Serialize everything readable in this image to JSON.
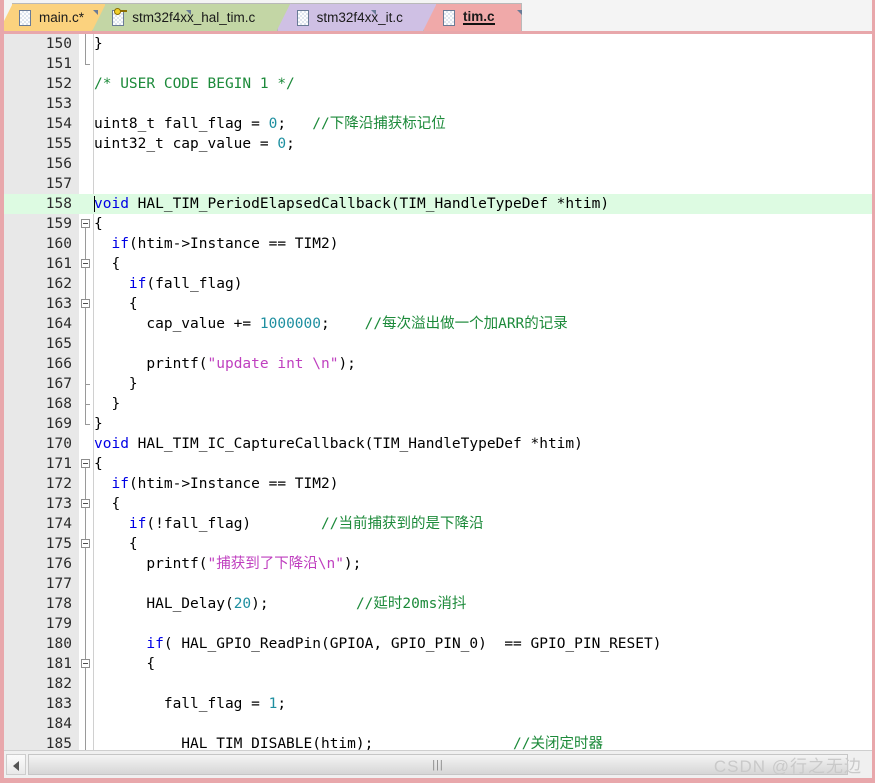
{
  "tabs": [
    {
      "label": "main.c*",
      "color": "#fbd27e",
      "icon": "file-icon",
      "active": false,
      "modified": true
    },
    {
      "label": "stm32f4xx_hal_tim.c",
      "color": "#c3d6a5",
      "icon": "file-key-icon",
      "active": false,
      "modified": false
    },
    {
      "label": "stm32f4xx_it.c",
      "color": "#cfc0e4",
      "icon": "file-icon",
      "active": false,
      "modified": false
    },
    {
      "label": "tim.c",
      "color": "#f0a9a9",
      "icon": "file-icon",
      "active": true,
      "modified": false
    }
  ],
  "editor": {
    "language": "c",
    "current_line": 158,
    "colors": {
      "keyword": "#0000e6",
      "comment": "#1c8a3a",
      "string": "#bf3fbf",
      "number": "#1e8fa0",
      "plain": "#000000",
      "current_line_bg": "#ddfbe2",
      "gutter_bg": "#e8e8e8",
      "frame": "#e8a7ab"
    },
    "lines": [
      {
        "n": "150",
        "fold": "elbow-start",
        "tokens": [
          {
            "t": "}",
            "c": "pln"
          }
        ]
      },
      {
        "n": "151",
        "fold": "elbow-end",
        "tokens": [
          {
            "t": "",
            "c": "pln"
          }
        ]
      },
      {
        "n": "152",
        "fold": "none",
        "tokens": [
          {
            "t": "/* USER CODE BEGIN 1 */",
            "c": "cmt"
          }
        ]
      },
      {
        "n": "153",
        "fold": "none",
        "tokens": [
          {
            "t": "",
            "c": "pln"
          }
        ]
      },
      {
        "n": "154",
        "fold": "none",
        "tokens": [
          {
            "t": "uint8_t fall_flag = ",
            "c": "pln"
          },
          {
            "t": "0",
            "c": "num"
          },
          {
            "t": ";   ",
            "c": "pln"
          },
          {
            "t": "//下降沿捕获标记位",
            "c": "cmt"
          }
        ]
      },
      {
        "n": "155",
        "fold": "none",
        "tokens": [
          {
            "t": "uint32_t cap_value = ",
            "c": "pln"
          },
          {
            "t": "0",
            "c": "num"
          },
          {
            "t": ";",
            "c": "pln"
          }
        ]
      },
      {
        "n": "156",
        "fold": "none",
        "tokens": [
          {
            "t": "",
            "c": "pln"
          }
        ]
      },
      {
        "n": "157",
        "fold": "none",
        "tokens": [
          {
            "t": "",
            "c": "pln"
          }
        ]
      },
      {
        "n": "158",
        "fold": "none",
        "current": true,
        "caret": true,
        "tokens": [
          {
            "t": "void",
            "c": "kw"
          },
          {
            "t": " HAL_TIM_PeriodElapsedCallback(TIM_HandleTypeDef *htim)",
            "c": "pln"
          }
        ]
      },
      {
        "n": "159",
        "fold": "box",
        "tokens": [
          {
            "t": "{",
            "c": "pln"
          }
        ]
      },
      {
        "n": "160",
        "fold": "line",
        "tokens": [
          {
            "t": "  ",
            "c": "pln"
          },
          {
            "t": "if",
            "c": "kw"
          },
          {
            "t": "(htim->Instance == TIM2)",
            "c": "pln"
          }
        ]
      },
      {
        "n": "161",
        "fold": "box-line",
        "tokens": [
          {
            "t": "  {",
            "c": "pln"
          }
        ]
      },
      {
        "n": "162",
        "fold": "line",
        "tokens": [
          {
            "t": "    ",
            "c": "pln"
          },
          {
            "t": "if",
            "c": "kw"
          },
          {
            "t": "(fall_flag)",
            "c": "pln"
          }
        ]
      },
      {
        "n": "163",
        "fold": "box-line",
        "tokens": [
          {
            "t": "    {",
            "c": "pln"
          }
        ]
      },
      {
        "n": "164",
        "fold": "line",
        "tokens": [
          {
            "t": "      cap_value += ",
            "c": "pln"
          },
          {
            "t": "1000000",
            "c": "num"
          },
          {
            "t": ";    ",
            "c": "pln"
          },
          {
            "t": "//每次溢出做一个加ARR的记录",
            "c": "cmt"
          }
        ]
      },
      {
        "n": "165",
        "fold": "line",
        "tokens": [
          {
            "t": "",
            "c": "pln"
          }
        ]
      },
      {
        "n": "166",
        "fold": "line",
        "tokens": [
          {
            "t": "      printf(",
            "c": "pln"
          },
          {
            "t": "\"update int \\n\"",
            "c": "str"
          },
          {
            "t": ");",
            "c": "pln"
          }
        ]
      },
      {
        "n": "167",
        "fold": "tick",
        "tokens": [
          {
            "t": "    }",
            "c": "pln"
          }
        ]
      },
      {
        "n": "168",
        "fold": "tick",
        "tokens": [
          {
            "t": "  }",
            "c": "pln"
          }
        ]
      },
      {
        "n": "169",
        "fold": "elbow-close",
        "tokens": [
          {
            "t": "}",
            "c": "pln"
          }
        ]
      },
      {
        "n": "170",
        "fold": "none",
        "tokens": [
          {
            "t": "void",
            "c": "kw"
          },
          {
            "t": " HAL_TIM_IC_CaptureCallback(TIM_HandleTypeDef *htim)",
            "c": "pln"
          }
        ]
      },
      {
        "n": "171",
        "fold": "box",
        "tokens": [
          {
            "t": "{",
            "c": "pln"
          }
        ]
      },
      {
        "n": "172",
        "fold": "line",
        "tokens": [
          {
            "t": "  ",
            "c": "pln"
          },
          {
            "t": "if",
            "c": "kw"
          },
          {
            "t": "(htim->Instance == TIM2)",
            "c": "pln"
          }
        ]
      },
      {
        "n": "173",
        "fold": "box-line",
        "tokens": [
          {
            "t": "  {",
            "c": "pln"
          }
        ]
      },
      {
        "n": "174",
        "fold": "line",
        "tokens": [
          {
            "t": "    ",
            "c": "pln"
          },
          {
            "t": "if",
            "c": "kw"
          },
          {
            "t": "(!fall_flag)",
            "c": "pln"
          },
          {
            "t": "        ",
            "c": "pln"
          },
          {
            "t": "//当前捕获到的是下降沿",
            "c": "cmt"
          }
        ]
      },
      {
        "n": "175",
        "fold": "box-line",
        "tokens": [
          {
            "t": "    {",
            "c": "pln"
          }
        ]
      },
      {
        "n": "176",
        "fold": "line",
        "tokens": [
          {
            "t": "      printf(",
            "c": "pln"
          },
          {
            "t": "\"捕获到了下降沿\\n\"",
            "c": "str"
          },
          {
            "t": ");",
            "c": "pln"
          }
        ]
      },
      {
        "n": "177",
        "fold": "line",
        "tokens": [
          {
            "t": "",
            "c": "pln"
          }
        ]
      },
      {
        "n": "178",
        "fold": "line",
        "tokens": [
          {
            "t": "      HAL_Delay(",
            "c": "pln"
          },
          {
            "t": "20",
            "c": "num"
          },
          {
            "t": ");",
            "c": "pln"
          },
          {
            "t": "          ",
            "c": "pln"
          },
          {
            "t": "//延时20ms消抖",
            "c": "cmt"
          }
        ]
      },
      {
        "n": "179",
        "fold": "line",
        "tokens": [
          {
            "t": "",
            "c": "pln"
          }
        ]
      },
      {
        "n": "180",
        "fold": "line",
        "tokens": [
          {
            "t": "      ",
            "c": "pln"
          },
          {
            "t": "if",
            "c": "kw"
          },
          {
            "t": "( HAL_GPIO_ReadPin(GPIOA, GPIO_PIN_0)  == GPIO_PIN_RESET)",
            "c": "pln"
          }
        ]
      },
      {
        "n": "181",
        "fold": "box-line",
        "tokens": [
          {
            "t": "      {",
            "c": "pln"
          }
        ]
      },
      {
        "n": "182",
        "fold": "line",
        "tokens": [
          {
            "t": "",
            "c": "pln"
          }
        ]
      },
      {
        "n": "183",
        "fold": "line",
        "tokens": [
          {
            "t": "        fall_flag = ",
            "c": "pln"
          },
          {
            "t": "1",
            "c": "num"
          },
          {
            "t": ";",
            "c": "pln"
          }
        ]
      },
      {
        "n": "184",
        "fold": "line",
        "tokens": [
          {
            "t": "",
            "c": "pln"
          }
        ]
      },
      {
        "n": "185",
        "fold": "line",
        "tokens": [
          {
            "t": "        __HAL_TIM_DISABLE(htim);",
            "c": "pln"
          },
          {
            "t": "                ",
            "c": "pln"
          },
          {
            "t": "//关闭定时器",
            "c": "cmt"
          }
        ]
      }
    ]
  },
  "scrollbar": {
    "grip": "|||"
  },
  "watermark": {
    "text": "CSDN @行之无边"
  }
}
